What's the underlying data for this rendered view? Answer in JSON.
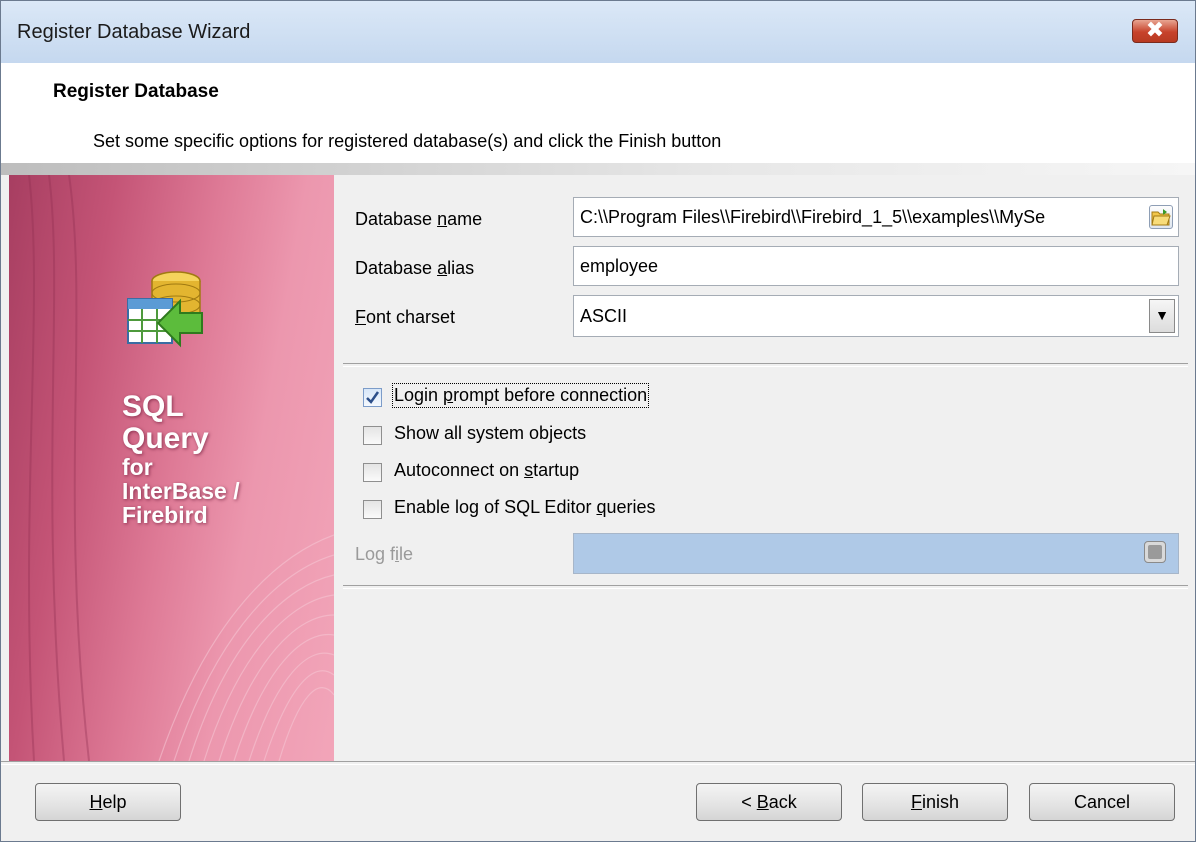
{
  "window": {
    "title": "Register Database Wizard",
    "close_glyph": "✖"
  },
  "header": {
    "title": "Register Database",
    "description": "Set some specific options for registered database(s) and click the Finish button"
  },
  "banner": {
    "line1": "SQL",
    "line2": "Query",
    "line3": "for",
    "line4": "InterBase /",
    "line5": "Firebird",
    "icon": "database-table-arrow-icon"
  },
  "form": {
    "db_name": {
      "label_pre": "Database ",
      "label_u": "n",
      "label_post": "ame",
      "value": "C:\\\\Program Files\\\\Firebird\\\\Firebird_1_5\\\\examples\\\\MySe"
    },
    "db_alias": {
      "label_pre": "Database ",
      "label_u": "a",
      "label_post": "lias",
      "value": "employee"
    },
    "charset": {
      "label_pre": "",
      "label_u": "F",
      "label_post": "ont charset",
      "value": "ASCII"
    }
  },
  "options": {
    "login_prompt": {
      "pre": "Login ",
      "u": "p",
      "post": "rompt before connection",
      "checked": true
    },
    "show_system": {
      "pre": "Show all system objects",
      "u": "",
      "post": "",
      "checked": false
    },
    "autoconnect": {
      "pre": "Autoconnect on ",
      "u": "s",
      "post": "tartup",
      "checked": false
    },
    "enable_log": {
      "pre": "Enable log of SQL Editor ",
      "u": "q",
      "post": "ueries",
      "checked": false
    }
  },
  "log_file": {
    "label_pre": "Log f",
    "label_u": "i",
    "label_post": "le",
    "value": ""
  },
  "buttons": {
    "help": {
      "u": "H",
      "rest": "elp"
    },
    "back": {
      "pre": "< ",
      "u": "B",
      "rest": "ack"
    },
    "finish": {
      "u": "F",
      "rest": "inish"
    },
    "cancel": {
      "label": "Cancel"
    }
  },
  "colors": {
    "banner_pink": "#de7a96",
    "log_field_disabled": "#afc9e7"
  }
}
